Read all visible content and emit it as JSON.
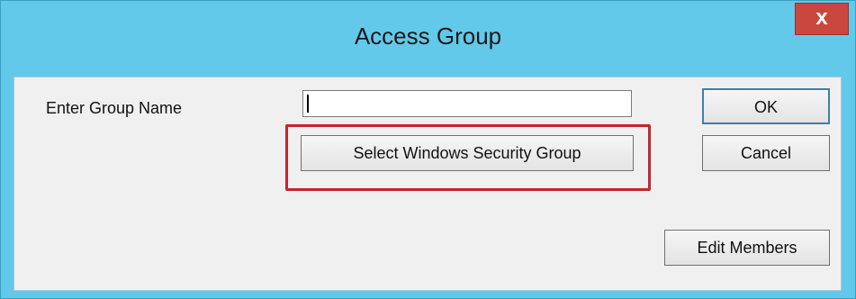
{
  "window": {
    "title": "Access Group",
    "close_glyph": "x",
    "close_icon": "close-icon"
  },
  "form": {
    "group_name_label": "Enter Group Name",
    "group_name_value": "",
    "select_security_group_label": "Select Windows Security Group",
    "ok_label": "OK",
    "cancel_label": "Cancel",
    "edit_members_label": "Edit Members"
  },
  "colors": {
    "titlebar": "#63c9ea",
    "close_button": "#c9473f",
    "highlight_annotation": "#c0272d"
  }
}
